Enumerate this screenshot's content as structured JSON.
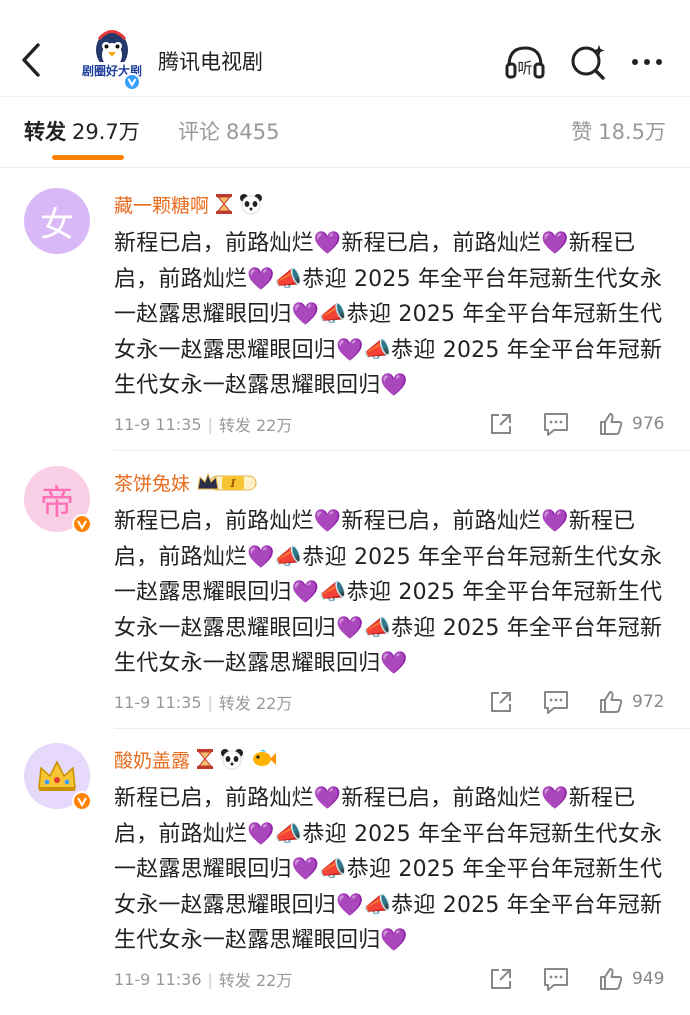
{
  "header": {
    "account_name": "腾讯电视剧",
    "logo_text": "剧圈好大剧",
    "back_icon": "chevron-left-icon",
    "actions": [
      "listen-icon",
      "search-icon",
      "more-icon"
    ],
    "listen_label": "听"
  },
  "tabs": {
    "repost": {
      "label": "转发",
      "count": "29.7万"
    },
    "comment": {
      "label": "评论",
      "count": "8455"
    },
    "like": {
      "label": "赞",
      "count": "18.5万"
    },
    "active": "repost",
    "accent_color": "#ff8200"
  },
  "comments": [
    {
      "username": "藏一颗糖啊",
      "avatar_char": "女",
      "verified": false,
      "badges": [
        "hourglass",
        "panda"
      ],
      "text": "新程已启，前路灿烂💜新程已启，前路灿烂💜新程已启，前路灿烂💜📣恭迎 2025 年全平台年冠新生代女永一赵露思耀眼回归💜📣恭迎 2025 年全平台年冠新生代女永一赵露思耀眼回归💜📣恭迎 2025 年全平台年冠新生代女永一赵露思耀眼回归💜",
      "time": "11-9 11:35",
      "repost": "转发 22万",
      "likes": "976"
    },
    {
      "username": "茶饼兔妹",
      "avatar_char": "帝",
      "verified": true,
      "badges": [
        "vip-crown-level-1"
      ],
      "badge_level": "I",
      "text": "新程已启，前路灿烂💜新程已启，前路灿烂💜新程已启，前路灿烂💜📣恭迎 2025 年全平台年冠新生代女永一赵露思耀眼回归💜📣恭迎 2025 年全平台年冠新生代女永一赵露思耀眼回归💜📣恭迎 2025 年全平台年冠新生代女永一赵露思耀眼回归💜",
      "time": "11-9 11:35",
      "repost": "转发 22万",
      "likes": "972"
    },
    {
      "username": "酸奶盖露",
      "avatar_char": "👑",
      "verified": true,
      "badges": [
        "hourglass",
        "panda",
        "fish"
      ],
      "text": "新程已启，前路灿烂💜新程已启，前路灿烂💜新程已启，前路灿烂💜📣恭迎 2025 年全平台年冠新生代女永一赵露思耀眼回归💜📣恭迎 2025 年全平台年冠新生代女永一赵露思耀眼回归💜📣恭迎 2025 年全平台年冠新生代女永一赵露思耀眼回归💜",
      "time": "11-9 11:36",
      "repost": "转发 22万",
      "likes": "949"
    }
  ]
}
